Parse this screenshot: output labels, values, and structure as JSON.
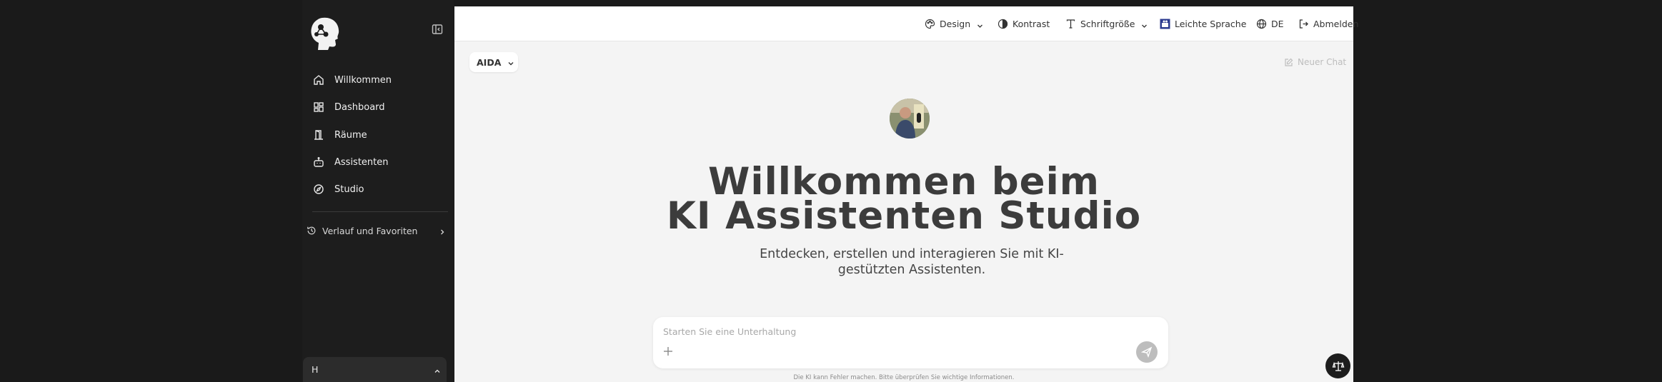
{
  "sidebar": {
    "nav_items": [
      {
        "label": "Willkommen",
        "icon": "home-icon"
      },
      {
        "label": "Dashboard",
        "icon": "dashboard-icon"
      },
      {
        "label": "Räume",
        "icon": "door-icon"
      },
      {
        "label": "Assistenten",
        "icon": "robot-icon"
      },
      {
        "label": "Studio",
        "icon": "compass-icon"
      }
    ],
    "history_label": "Verlauf und Favoriten",
    "user_initial": "H"
  },
  "topbar": {
    "design_label": "Design",
    "contrast_label": "Kontrast",
    "font_size_label": "Schriftgröße",
    "easy_language_label": "Leichte Sprache",
    "language_label": "DE",
    "logout_label": "Abmelden"
  },
  "main": {
    "model_selected": "AIDA",
    "new_chat_label": "Neuer Chat",
    "hero_line1": "Willkommen beim",
    "hero_line2": "KI Assistenten Studio",
    "subtitle": "Entdecken, erstellen und interagieren Sie mit KI-gestützten Assistenten.",
    "chat_placeholder": "Starten Sie eine Unterhaltung",
    "disclaimer": "Die KI kann Fehler machen. Bitte überprüfen Sie wichtige Informationen."
  },
  "colors": {
    "sidebar_bg": "#1d1d1d",
    "main_bg": "#f4f4f4",
    "easy_language_badge": "#2b3a8f"
  }
}
